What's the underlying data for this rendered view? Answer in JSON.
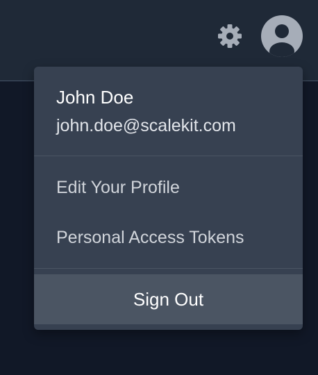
{
  "header": {
    "settings_icon": "gear-icon",
    "avatar_icon": "user-avatar-icon"
  },
  "user_menu": {
    "name": "John Doe",
    "email": "john.doe@scalekit.com",
    "items": [
      {
        "label": "Edit Your Profile"
      },
      {
        "label": "Personal Access Tokens"
      }
    ],
    "sign_out_label": "Sign Out"
  },
  "colors": {
    "page_background": "#111827",
    "topbar_background": "#1f2937",
    "menu_background": "#374151",
    "sign_out_background": "#4b5563",
    "icon_color": "#a6adb8"
  }
}
